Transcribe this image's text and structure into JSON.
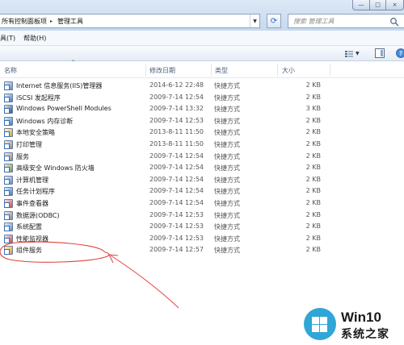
{
  "address": {
    "crumbs": [
      "所有控制面板项",
      "管理工具"
    ],
    "separator": "▸"
  },
  "search": {
    "placeholder": "搜索 管理工具"
  },
  "window_controls": {
    "minimize": "—",
    "maximize": "□",
    "close": "×"
  },
  "menu": {
    "items": [
      "具(T)",
      "帮助(H)"
    ]
  },
  "toolbar": {
    "help_glyph": "?"
  },
  "columns": {
    "name": "名称",
    "date": "修改日期",
    "type": "类型",
    "size": "大小"
  },
  "files": [
    {
      "name": "Internet 信息服务(IIS)管理器",
      "date": "2014-6-12 22:48",
      "type": "快捷方式",
      "size": "2 KB",
      "icon": "iis-icon"
    },
    {
      "name": "iSCSI 发起程序",
      "date": "2009-7-14 12:54",
      "type": "快捷方式",
      "size": "2 KB",
      "icon": "iscsi-icon"
    },
    {
      "name": "Windows PowerShell Modules",
      "date": "2009-7-14 13:32",
      "type": "快捷方式",
      "size": "3 KB",
      "icon": "powershell-icon"
    },
    {
      "name": "Windows 内存诊断",
      "date": "2009-7-14 12:53",
      "type": "快捷方式",
      "size": "2 KB",
      "icon": "memory-diagnostic-icon"
    },
    {
      "name": "本地安全策略",
      "date": "2013-8-11 11:50",
      "type": "快捷方式",
      "size": "2 KB",
      "icon": "security-policy-icon"
    },
    {
      "name": "打印管理",
      "date": "2013-8-11 11:50",
      "type": "快捷方式",
      "size": "2 KB",
      "icon": "print-management-icon"
    },
    {
      "name": "服务",
      "date": "2009-7-14 12:54",
      "type": "快捷方式",
      "size": "2 KB",
      "icon": "services-icon"
    },
    {
      "name": "高级安全 Windows 防火墙",
      "date": "2009-7-14 12:54",
      "type": "快捷方式",
      "size": "2 KB",
      "icon": "firewall-icon"
    },
    {
      "name": "计算机管理",
      "date": "2009-7-14 12:54",
      "type": "快捷方式",
      "size": "2 KB",
      "icon": "computer-management-icon"
    },
    {
      "name": "任务计划程序",
      "date": "2009-7-14 12:54",
      "type": "快捷方式",
      "size": "2 KB",
      "icon": "task-scheduler-icon"
    },
    {
      "name": "事件查看器",
      "date": "2009-7-14 12:54",
      "type": "快捷方式",
      "size": "2 KB",
      "icon": "event-viewer-icon"
    },
    {
      "name": "数据源(ODBC)",
      "date": "2009-7-14 12:53",
      "type": "快捷方式",
      "size": "2 KB",
      "icon": "odbc-icon"
    },
    {
      "name": "系统配置",
      "date": "2009-7-14 12:53",
      "type": "快捷方式",
      "size": "2 KB",
      "icon": "system-config-icon"
    },
    {
      "name": "性能监视器",
      "date": "2009-7-14 12:53",
      "type": "快捷方式",
      "size": "2 KB",
      "icon": "performance-monitor-icon"
    },
    {
      "name": "组件服务",
      "date": "2009-7-14 12:57",
      "type": "快捷方式",
      "size": "2 KB",
      "icon": "component-services-icon"
    }
  ],
  "watermark": {
    "line1": "Win10",
    "line2": "系统之家"
  },
  "colors": {
    "annotation": "#e0413a",
    "watermark_blue": "#2fa6d6"
  }
}
